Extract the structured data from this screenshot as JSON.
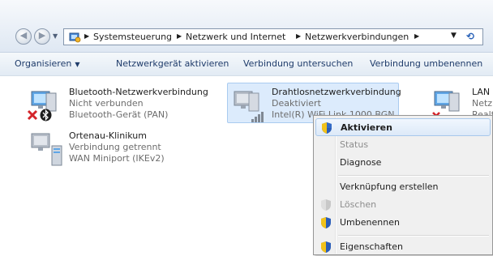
{
  "address": {
    "crumbs": [
      "Systemsteuerung",
      "Netzwerk und Internet",
      "Netzwerkverbindungen"
    ]
  },
  "toolbar": {
    "organize": "Organisieren",
    "activate": "Netzwerkgerät aktivieren",
    "diagnose": "Verbindung untersuchen",
    "rename": "Verbindung umbenennen"
  },
  "connections": [
    {
      "name": "Bluetooth-Netzwerkverbindung",
      "status": "Nicht verbunden",
      "device": "Bluetooth-Gerät (PAN)"
    },
    {
      "name": "Drahtlosnetzwerkverbindung",
      "status": "Deaktiviert",
      "device": "Intel(R) WiFi Link 1000 BGN"
    },
    {
      "name": "LAN",
      "status": "Netz",
      "device": "Realt"
    },
    {
      "name": "Ortenau-Klinikum",
      "status": "Verbindung getrennt",
      "device": "WAN Miniport (IKEv2)"
    }
  ],
  "context_menu": {
    "items": [
      {
        "label": "Aktivieren"
      },
      {
        "label": "Status"
      },
      {
        "label": "Diagnose"
      },
      {
        "label": "Verknüpfung erstellen"
      },
      {
        "label": "Löschen"
      },
      {
        "label": "Umbenennen"
      },
      {
        "label": "Eigenschaften"
      }
    ]
  },
  "colors": {
    "toolbar_text": "#1e3b6a",
    "selection_bg": "#dcebfc",
    "error_red": "#d4252a",
    "shield_blue": "#2a5db8",
    "shield_yellow": "#f2c21a"
  },
  "icons": [
    "back-arrow-icon",
    "forward-arrow-icon",
    "control-panel-icon",
    "refresh-icon",
    "computer-network-icon",
    "bluetooth-icon",
    "error-x-icon",
    "wifi-bars-icon",
    "modem-icon",
    "uac-shield-icon"
  ]
}
